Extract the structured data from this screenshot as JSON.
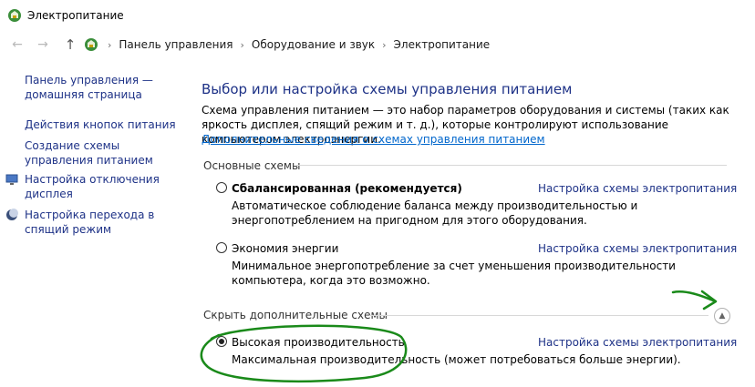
{
  "window": {
    "title": "Электропитание"
  },
  "breadcrumb": [
    "Панель управления",
    "Оборудование и звук",
    "Электропитание"
  ],
  "sidebar": {
    "items": [
      {
        "label": "Панель управления — домашняя страница",
        "icon": null
      },
      {
        "label": "Действия кнопок питания",
        "icon": null
      },
      {
        "label": "Создание схемы управления питанием",
        "icon": null
      },
      {
        "label": "Настройка отключения дисплея",
        "icon": "monitor-icon"
      },
      {
        "label": "Настройка перехода в спящий режим",
        "icon": "moon-sleep-icon"
      }
    ]
  },
  "main": {
    "heading": "Выбор или настройка схемы управления питанием",
    "description": "Схема управления питанием — это набор параметров оборудования и системы (таких как яркость дисплея, спящий режим и т. д.), которые контролируют использование компьютером электроэнергии.",
    "more_link": "Дополнительные сведения о схемах управления питанием",
    "basic_group_label": "Основные схемы",
    "hidden_group_label": "Скрыть дополнительные схемы",
    "plan_settings_link": "Настройка схемы электропитания",
    "plans": [
      {
        "name": "Сбалансированная (рекомендуется)",
        "bold": true,
        "checked": false,
        "description": "Автоматическое соблюдение баланса между производительностью и энергопотреблением на пригодном для этого оборудования."
      },
      {
        "name": "Экономия энергии",
        "bold": false,
        "checked": false,
        "description": "Минимальное энергопотребление за счет уменьшения производительности компьютера, когда это возможно."
      },
      {
        "name": "Высокая производительность",
        "bold": false,
        "checked": true,
        "description": "Максимальная производительность (может потребоваться больше энергии)."
      }
    ]
  },
  "colors": {
    "link": "#1e3287",
    "annotation": "#1a8a1a"
  }
}
